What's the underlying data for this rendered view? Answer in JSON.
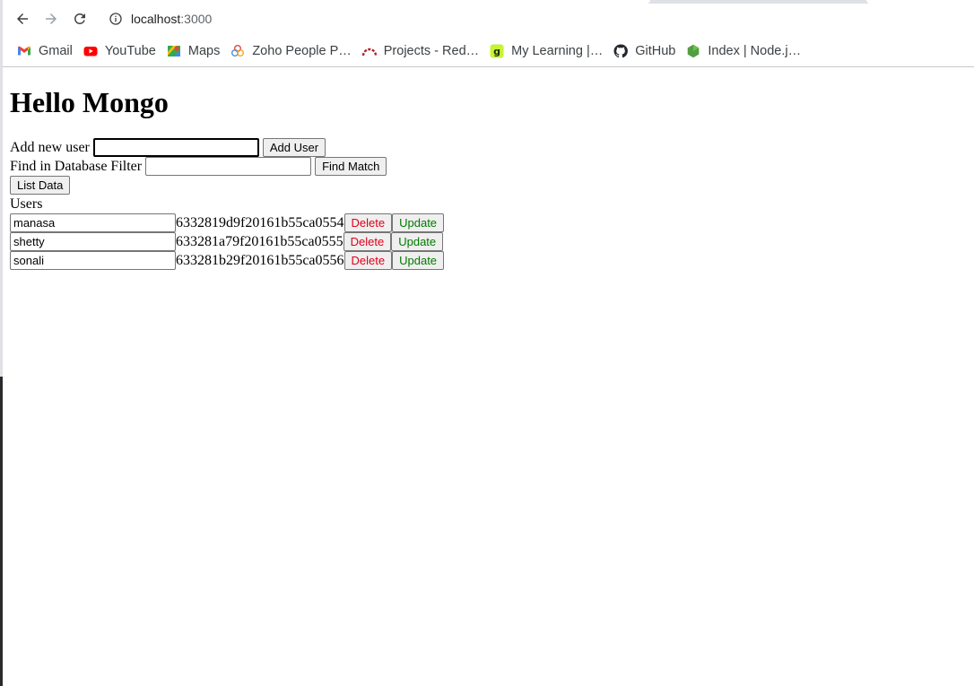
{
  "browser": {
    "url_host": "localhost",
    "url_port": ":3000",
    "bookmarks": [
      {
        "label": "Gmail",
        "icon": "gmail-icon"
      },
      {
        "label": "YouTube",
        "icon": "youtube-icon"
      },
      {
        "label": "Maps",
        "icon": "maps-icon"
      },
      {
        "label": "Zoho People P…",
        "icon": "zoho-icon"
      },
      {
        "label": "Projects - Red…",
        "icon": "redmine-icon"
      },
      {
        "label": "My Learning |…",
        "icon": "learning-icon"
      },
      {
        "label": "GitHub",
        "icon": "github-icon"
      },
      {
        "label": "Index | Node.j…",
        "icon": "nodejs-icon"
      }
    ]
  },
  "page": {
    "title": "Hello Mongo",
    "add_user": {
      "label": "Add new user",
      "value": "",
      "button": "Add User"
    },
    "find": {
      "label": "Find in Database Filter",
      "value": "",
      "button": "Find Match"
    },
    "list_button": "List Data",
    "users_heading": "Users",
    "users": [
      {
        "name": "manasa",
        "id": "6332819d9f20161b55ca0554",
        "delete": "Delete",
        "update": "Update"
      },
      {
        "name": "shetty",
        "id": "633281a79f20161b55ca0555",
        "delete": "Delete",
        "update": "Update"
      },
      {
        "name": "sonali",
        "id": "633281b29f20161b55ca0556",
        "delete": "Delete",
        "update": "Update"
      }
    ]
  },
  "colors": {
    "delete": "#e0001a",
    "update": "#007a00"
  }
}
